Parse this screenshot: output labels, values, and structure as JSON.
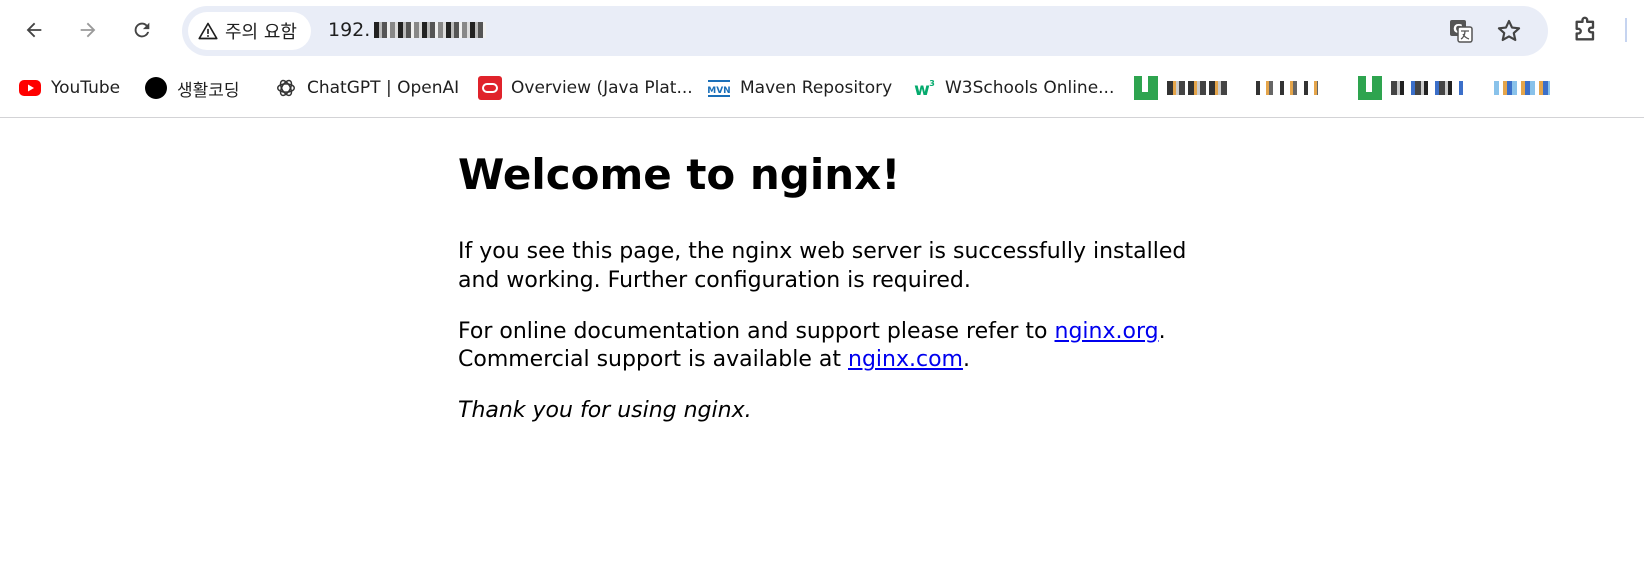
{
  "toolbar": {
    "security_label": "주의 요함",
    "url_prefix": "192."
  },
  "bookmarks": [
    {
      "label": "YouTube",
      "icon": "youtube-icon"
    },
    {
      "label": "생활코딩",
      "icon": "black-circle-icon"
    },
    {
      "label": "ChatGPT | OpenAI",
      "icon": "openai-icon"
    },
    {
      "label": "Overview (Java Plat...",
      "icon": "oracle-icon"
    },
    {
      "label": "Maven Repository",
      "icon": "mvn-icon"
    },
    {
      "label": "W3Schools Online...",
      "icon": "w3schools-icon"
    }
  ],
  "page": {
    "heading": "Welcome to nginx!",
    "p1": "If you see this page, the nginx web server is successfully installed and working. Further configuration is required.",
    "p2_before": "For online documentation and support please refer to ",
    "p2_link1": "nginx.org",
    "p2_mid": ".",
    "p2_line2": "Commercial support is available at ",
    "p2_link2": "nginx.com",
    "p2_end": ".",
    "p3": "Thank you for using nginx."
  },
  "colors": {
    "link": "#0000ee",
    "omnibox_bg": "#e9edf7",
    "youtube_red": "#ff0000",
    "oracle_red": "#e0232b",
    "w3_green": "#04aa6d"
  }
}
